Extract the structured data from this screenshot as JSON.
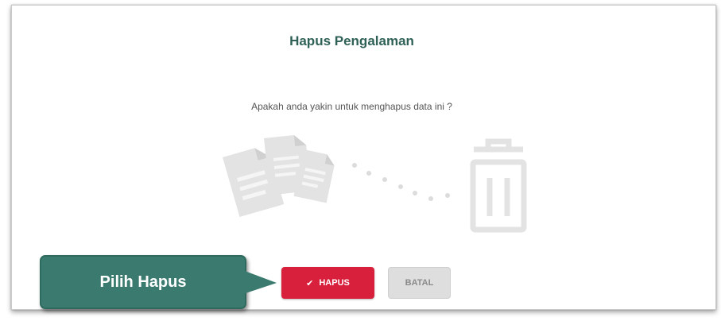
{
  "dialog": {
    "title": "Hapus Pengalaman",
    "question": "Apakah anda yakin untuk menghapus data ini ?",
    "illustration": [
      "documents-icon",
      "trash-icon"
    ]
  },
  "buttons": {
    "hapus": {
      "label": "HAPUS",
      "icon": "check-icon",
      "color": "#d8203c"
    },
    "batal": {
      "label": "BATAL",
      "color": "#dedede"
    }
  },
  "callout": {
    "label": "Pilih Hapus",
    "color": "#3b7b6f"
  }
}
